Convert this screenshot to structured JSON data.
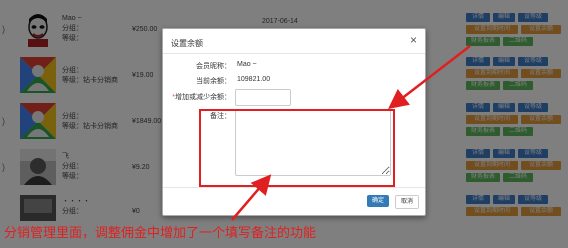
{
  "rows": [
    {
      "lead": ")",
      "name": "Mao ~",
      "line2": "分组：",
      "line3": "等级：",
      "price": "¥250.00",
      "date": "2017-06-14",
      "avatar": "face-avatar"
    },
    {
      "lead": "",
      "name": "",
      "line2": "分组：",
      "line3": "等级：钻卡分销商",
      "price": "¥19.00",
      "date": "",
      "avatar": "default-avatar"
    },
    {
      "lead": ")",
      "name": "",
      "line2": "分组：",
      "line3": "等级：钻卡分销商",
      "price": "¥1849.00",
      "date": "",
      "avatar": "default-avatar"
    },
    {
      "lead": ")",
      "name": "飞",
      "line2": "分组：",
      "line3": "等级：",
      "price": "¥9.20",
      "date": "",
      "avatar": "photo-avatar"
    },
    {
      "lead": "",
      "name": "・・・・",
      "line2": "分组：",
      "line3": "",
      "price": "¥0",
      "date": "",
      "avatar": "photo-avatar"
    }
  ],
  "actions": {
    "detail": "详情",
    "edit": "编辑",
    "set_level": "设等级",
    "set_expiry": "设置到期时间",
    "set_balance": "设置余额",
    "finance_report": "财务报表",
    "qrcode": "二维码"
  },
  "modal": {
    "title": "设置余额",
    "close": "×",
    "member_label": "会员昵称：",
    "member_value": "Mao ~",
    "balance_label": "当前余额：",
    "balance_value": "109821.00",
    "required_mark": "*",
    "amount_label": "增加或减少余额：",
    "remark_label": "备注：",
    "ok": "确定",
    "cancel": "取消"
  },
  "annotation": {
    "text": "分销管理里面，调整佣金中增加了一个填写备注的功能",
    "color": "#e02020"
  },
  "colors": {
    "primary": "#3d7cc9",
    "warning": "#e49a3c",
    "success": "#5cb85c",
    "danger": "#e02020"
  }
}
